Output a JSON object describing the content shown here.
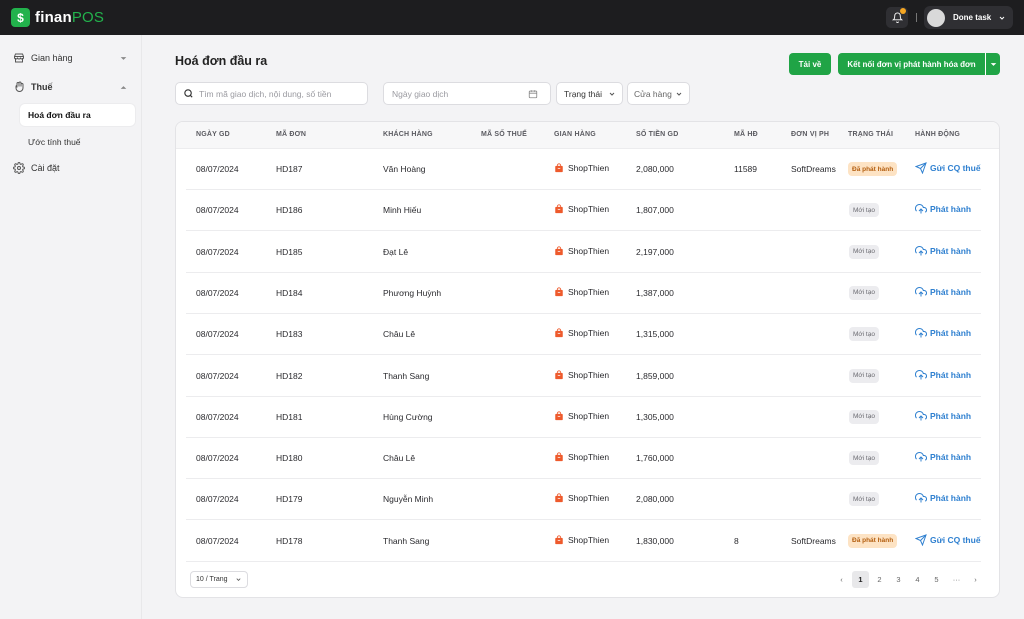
{
  "app": {
    "logo_mark": "$",
    "logo_text_a": "finan",
    "logo_text_b": "POS",
    "user_name": "Done task",
    "notification_icon": "bell-icon"
  },
  "sidebar": {
    "items": [
      {
        "label": "Gian hàng",
        "icon": "store-icon"
      },
      {
        "label": "Thuế",
        "icon": "hand-icon"
      },
      {
        "label": "Cài đặt",
        "icon": "gear-icon"
      }
    ],
    "sub_items": [
      {
        "label": "Hoá đơn đầu ra",
        "active": true
      },
      {
        "label": "Ước tính thuế",
        "active": false
      }
    ]
  },
  "page": {
    "title": "Hoá đơn đầu ra"
  },
  "toolbar": {
    "download_label": "Tải về",
    "connect_label": "Kết nối đơn vị phát hành hóa đơn"
  },
  "filters": {
    "search_placeholder": "Tìm mã giao dịch, nội dung, số tiền",
    "date_placeholder": "Ngày giao dịch",
    "status_label": "Trạng thái",
    "store_label": "Cửa hàng"
  },
  "table": {
    "headers": [
      "NGÀY GD",
      "MÃ ĐƠN",
      "KHÁCH HÀNG",
      "MÃ SỐ THUẾ",
      "GIAN HÀNG",
      "SỐ TIỀN GD",
      "MÃ HĐ",
      "ĐƠN VỊ PH",
      "TRẠNG THÁI",
      "HÀNH ĐỘNG"
    ],
    "rows": [
      {
        "date": "08/07/2024",
        "order": "HD187",
        "customer": "Văn Hoàng",
        "tax": "",
        "store": "ShopThien",
        "amount": "2,080,000",
        "invoice": "11589",
        "issuer": "SoftDreams",
        "status": "Đã phát hành",
        "status_type": "issued",
        "action": "Gửi CQ thuế",
        "action_type": "send"
      },
      {
        "date": "08/07/2024",
        "order": "HD186",
        "customer": "Minh Hiếu",
        "tax": "",
        "store": "ShopThien",
        "amount": "1,807,000",
        "invoice": "",
        "issuer": "",
        "status": "Mới tạo",
        "status_type": "new",
        "action": "Phát hành",
        "action_type": "issue"
      },
      {
        "date": "08/07/2024",
        "order": "HD185",
        "customer": "Đạt Lê",
        "tax": "",
        "store": "ShopThien",
        "amount": "2,197,000",
        "invoice": "",
        "issuer": "",
        "status": "Mới tạo",
        "status_type": "new",
        "action": "Phát hành",
        "action_type": "issue"
      },
      {
        "date": "08/07/2024",
        "order": "HD184",
        "customer": "Phương Huỳnh",
        "tax": "",
        "store": "ShopThien",
        "amount": "1,387,000",
        "invoice": "",
        "issuer": "",
        "status": "Mới tạo",
        "status_type": "new",
        "action": "Phát hành",
        "action_type": "issue"
      },
      {
        "date": "08/07/2024",
        "order": "HD183",
        "customer": "Châu Lê",
        "tax": "",
        "store": "ShopThien",
        "amount": "1,315,000",
        "invoice": "",
        "issuer": "",
        "status": "Mới tạo",
        "status_type": "new",
        "action": "Phát hành",
        "action_type": "issue"
      },
      {
        "date": "08/07/2024",
        "order": "HD182",
        "customer": "Thanh Sang",
        "tax": "",
        "store": "ShopThien",
        "amount": "1,859,000",
        "invoice": "",
        "issuer": "",
        "status": "Mới tạo",
        "status_type": "new",
        "action": "Phát hành",
        "action_type": "issue"
      },
      {
        "date": "08/07/2024",
        "order": "HD181",
        "customer": "Hùng Cường",
        "tax": "",
        "store": "ShopThien",
        "amount": "1,305,000",
        "invoice": "",
        "issuer": "",
        "status": "Mới tạo",
        "status_type": "new",
        "action": "Phát hành",
        "action_type": "issue"
      },
      {
        "date": "08/07/2024",
        "order": "HD180",
        "customer": "Châu Lê",
        "tax": "",
        "store": "ShopThien",
        "amount": "1,760,000",
        "invoice": "",
        "issuer": "",
        "status": "Mới tạo",
        "status_type": "new",
        "action": "Phát hành",
        "action_type": "issue"
      },
      {
        "date": "08/07/2024",
        "order": "HD179",
        "customer": "Nguyễn Minh",
        "tax": "",
        "store": "ShopThien",
        "amount": "2,080,000",
        "invoice": "",
        "issuer": "",
        "status": "Mới tạo",
        "status_type": "new",
        "action": "Phát hành",
        "action_type": "issue"
      },
      {
        "date": "08/07/2024",
        "order": "HD178",
        "customer": "Thanh Sang",
        "tax": "",
        "store": "ShopThien",
        "amount": "1,830,000",
        "invoice": "8",
        "issuer": "SoftDreams",
        "status": "Đã phát hành",
        "status_type": "issued",
        "action": "Gửi CQ thuế",
        "action_type": "send"
      }
    ]
  },
  "pagination": {
    "page_size": "10 / Trang",
    "pages": [
      "1",
      "2",
      "3",
      "4",
      "5"
    ],
    "current": "1",
    "ellipsis": "···",
    "prev": "‹",
    "next": "›"
  },
  "colors": {
    "accent_green": "#20a446",
    "link_blue": "#2f80d0",
    "issued_bg": "#fde3c4",
    "new_bg": "#ececef"
  }
}
